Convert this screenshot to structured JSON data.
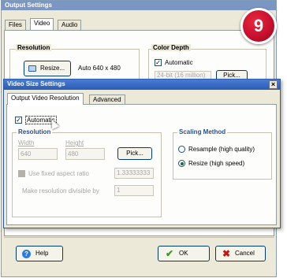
{
  "back_window": {
    "title": "Output Settings",
    "tabs": [
      "Files",
      "Video",
      "Audio"
    ],
    "resolution_group_label": "Resolution",
    "resize_button_label": "Resize...",
    "resolution_text": "Auto 640 x 480",
    "color_depth_group_label": "Color Depth",
    "automatic_label": "Automatic",
    "depth_field_value": "24-bit (16 million)",
    "pick_label": "Pick..."
  },
  "step_badge": {
    "number": "9",
    "color": "#c8102e"
  },
  "dialog": {
    "title": "Video Size Settings",
    "close_glyph": "×",
    "tabs": [
      "Output Video Resolution",
      "Advanced"
    ],
    "automatic_label": "Automatic",
    "automatic_checked": true,
    "resolution": {
      "label": "Resolution",
      "width_label": "Width",
      "height_label": "Height",
      "width_value": "640",
      "height_value": "480",
      "pick_label": "Pick...",
      "fixed_aspect_label": "Use fixed aspect ratio",
      "aspect_value": "1.33333333",
      "divisible_label": "Make resolution divisible by",
      "divisible_value": "1"
    },
    "scaling": {
      "label": "Scaling Method",
      "options": [
        "Resample (high quality)",
        "Resize (high speed)"
      ],
      "selected": "Resize (high speed)"
    }
  },
  "footer": {
    "help_label": "Help",
    "ok_label": "OK",
    "cancel_label": "Cancel"
  },
  "colors": {
    "titlebar": "#7b96c2",
    "dialog_titlebar": "#2a5cb3",
    "window_bg": "#ece9d8",
    "badge_red": "#c8102e",
    "ok_check": "#3a9a22",
    "cancel_x": "#c81414",
    "help_icon": "#2d7be0"
  },
  "icons": [
    "monitor-icon",
    "help-icon",
    "checkmark-icon",
    "x-icon",
    "cursor-icon",
    "close-icon"
  ]
}
